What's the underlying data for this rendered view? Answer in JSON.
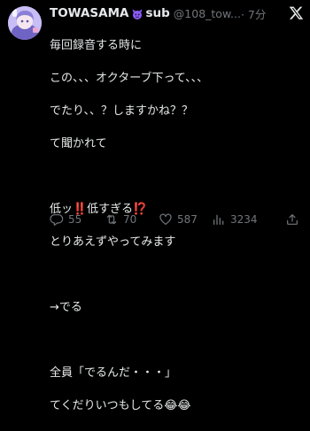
{
  "tweet": {
    "author": {
      "display_name": "TOWASAMA",
      "badge_icon": "purple-devil-horns-icon",
      "name_suffix": "sub",
      "handle": "@108_tow...",
      "time": "· 7分"
    },
    "lines": [
      "毎回録音する時に",
      "この、、、オクターブ下って、、、",
      "でたり、、？しますかね？？",
      "て聞かれて",
      "",
      "低ッ‼️低すぎる⁉️",
      "とりあえずやってみます",
      "",
      "→でる",
      "",
      "全員「でるんだ・・・」",
      "てくだりいつもしてる😂😂"
    ],
    "actions": {
      "replies": "55",
      "retweets": "70",
      "likes": "587",
      "views": "3234"
    }
  },
  "colors": {
    "background": "#000000",
    "text": "#e7e9ea",
    "muted": "#71767b",
    "badge": "#8b5cf6"
  }
}
